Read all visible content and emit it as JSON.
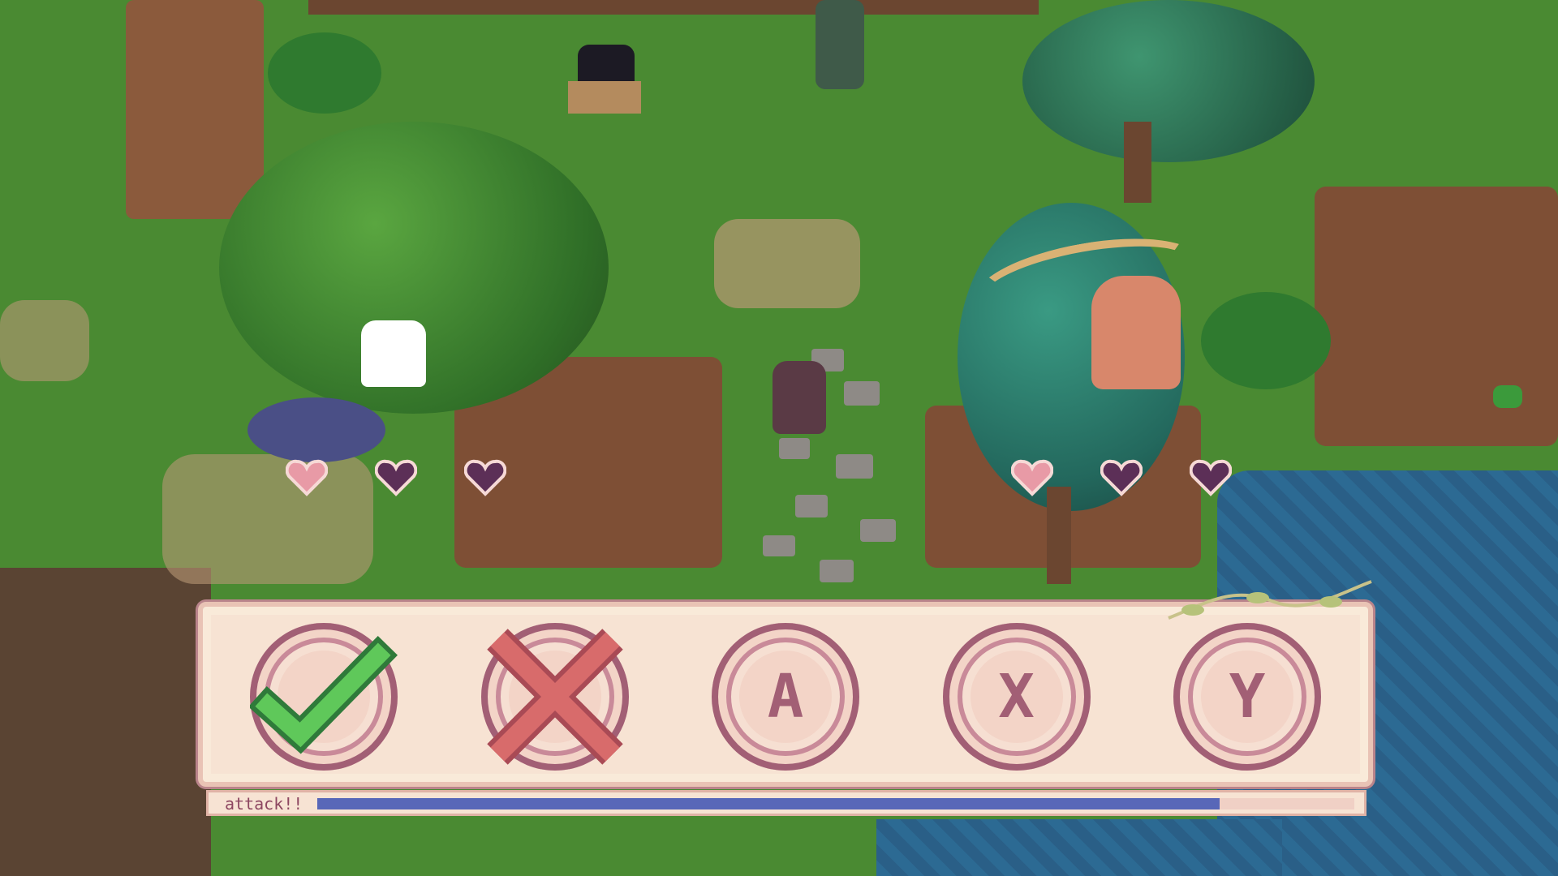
{
  "game": {
    "player_hearts": [
      {
        "state": "full",
        "color": "#e89aa6"
      },
      {
        "state": "empty",
        "color": "#5c2f57"
      },
      {
        "state": "empty",
        "color": "#5c2f57"
      }
    ],
    "enemy_hearts": [
      {
        "state": "full",
        "color": "#e89aa6"
      },
      {
        "state": "empty",
        "color": "#5c2f57"
      },
      {
        "state": "empty",
        "color": "#5c2f57"
      }
    ],
    "qte": {
      "buttons": [
        {
          "letter": "",
          "status": "success",
          "status_icon": "check-icon"
        },
        {
          "letter": "",
          "status": "failed",
          "status_icon": "cross-icon"
        },
        {
          "letter": "A",
          "status": "pending",
          "status_icon": ""
        },
        {
          "letter": "X",
          "status": "pending",
          "status_icon": ""
        },
        {
          "letter": "Y",
          "status": "pending",
          "status_icon": ""
        }
      ],
      "timer_label": "attack!!",
      "timer_progress": 0.87
    },
    "colors": {
      "panel_bg": "#f7e3d3",
      "accent": "#a25f75",
      "success": "#5fc85a",
      "fail": "#d86b6b",
      "timer": "#5867b8"
    }
  }
}
